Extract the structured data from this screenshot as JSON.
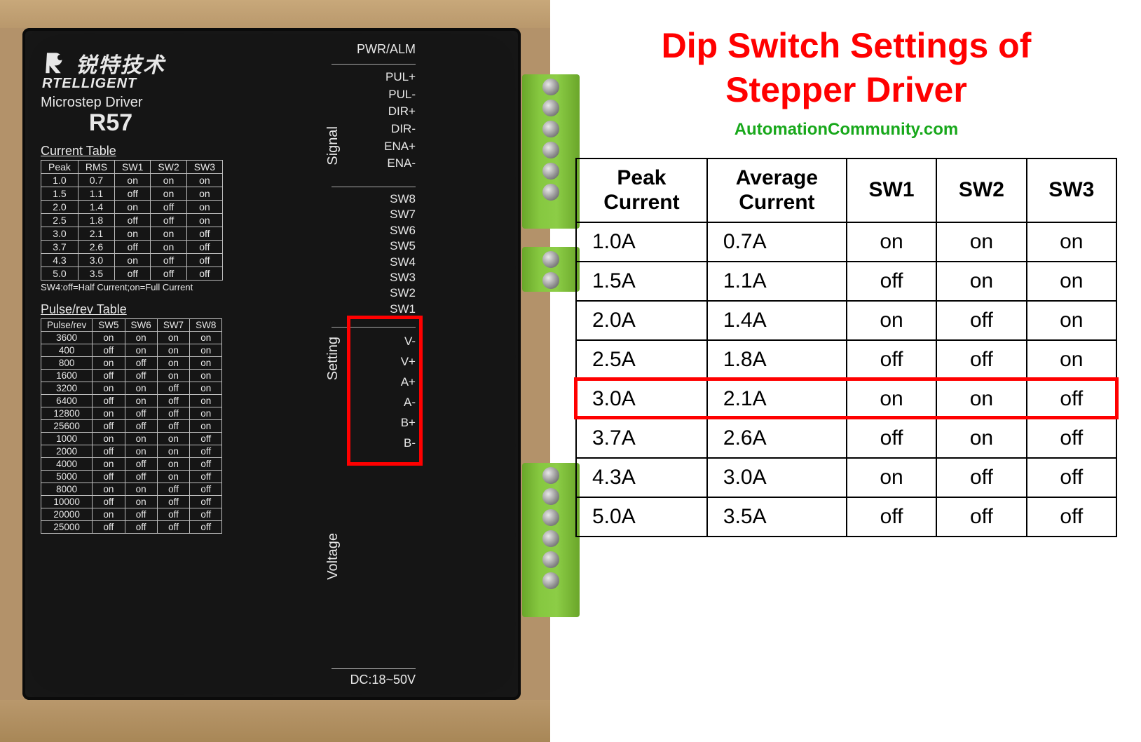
{
  "left": {
    "brand_cn": "锐特技术",
    "brand_en": "RTELLIGENT",
    "model_line": "Microstep Driver",
    "model": "R57",
    "current_table": {
      "title": "Current Table",
      "headers": [
        "Peak",
        "RMS",
        "SW1",
        "SW2",
        "SW3"
      ],
      "rows": [
        [
          "1.0",
          "0.7",
          "on",
          "on",
          "on"
        ],
        [
          "1.5",
          "1.1",
          "off",
          "on",
          "on"
        ],
        [
          "2.0",
          "1.4",
          "on",
          "off",
          "on"
        ],
        [
          "2.5",
          "1.8",
          "off",
          "off",
          "on"
        ],
        [
          "3.0",
          "2.1",
          "on",
          "on",
          "off"
        ],
        [
          "3.7",
          "2.6",
          "off",
          "on",
          "off"
        ],
        [
          "4.3",
          "3.0",
          "on",
          "off",
          "off"
        ],
        [
          "5.0",
          "3.5",
          "off",
          "off",
          "off"
        ]
      ],
      "note": "SW4:off=Half Current;on=Full Current"
    },
    "pulse_table": {
      "title": "Pulse/rev Table",
      "headers": [
        "Pulse/rev",
        "SW5",
        "SW6",
        "SW7",
        "SW8"
      ],
      "rows": [
        [
          "3600",
          "on",
          "on",
          "on",
          "on"
        ],
        [
          "400",
          "off",
          "on",
          "on",
          "on"
        ],
        [
          "800",
          "on",
          "off",
          "on",
          "on"
        ],
        [
          "1600",
          "off",
          "off",
          "on",
          "on"
        ],
        [
          "3200",
          "on",
          "on",
          "off",
          "on"
        ],
        [
          "6400",
          "off",
          "on",
          "off",
          "on"
        ],
        [
          "12800",
          "on",
          "off",
          "off",
          "on"
        ],
        [
          "25600",
          "off",
          "off",
          "off",
          "on"
        ],
        [
          "1000",
          "on",
          "on",
          "on",
          "off"
        ],
        [
          "2000",
          "off",
          "on",
          "on",
          "off"
        ],
        [
          "4000",
          "on",
          "off",
          "on",
          "off"
        ],
        [
          "5000",
          "off",
          "off",
          "on",
          "off"
        ],
        [
          "8000",
          "on",
          "on",
          "off",
          "off"
        ],
        [
          "10000",
          "off",
          "on",
          "off",
          "off"
        ],
        [
          "20000",
          "on",
          "off",
          "off",
          "off"
        ],
        [
          "25000",
          "off",
          "off",
          "off",
          "off"
        ]
      ]
    },
    "pins": {
      "pwr": "PWR/ALM",
      "signal_group": "Signal",
      "signal": [
        "PUL+",
        "PUL-",
        "DIR+",
        "DIR-",
        "ENA+",
        "ENA-"
      ],
      "setting_group": "Setting",
      "setting": [
        "SW8",
        "SW7",
        "SW6",
        "SW5",
        "SW4",
        "SW3",
        "SW2",
        "SW1"
      ],
      "voltage_group": "Voltage",
      "voltage": [
        "V-",
        "V+",
        "A+",
        "A-",
        "B+",
        "B-"
      ],
      "dc": "DC:18~50V"
    }
  },
  "right": {
    "title_line1": "Dip Switch Settings of",
    "title_line2": "Stepper Driver",
    "source": "AutomationCommunity.com",
    "headers": [
      "Peak Current",
      "Average Current",
      "SW1",
      "SW2",
      "SW3"
    ],
    "rows": [
      [
        "1.0A",
        "0.7A",
        "on",
        "on",
        "on"
      ],
      [
        "1.5A",
        "1.1A",
        "off",
        "on",
        "on"
      ],
      [
        "2.0A",
        "1.4A",
        "on",
        "off",
        "on"
      ],
      [
        "2.5A",
        "1.8A",
        "off",
        "off",
        "on"
      ],
      [
        "3.0A",
        "2.1A",
        "on",
        "on",
        "off"
      ],
      [
        "3.7A",
        "2.6A",
        "off",
        "on",
        "off"
      ],
      [
        "4.3A",
        "3.0A",
        "on",
        "off",
        "off"
      ],
      [
        "5.0A",
        "3.5A",
        "off",
        "off",
        "off"
      ]
    ],
    "highlight_row_index": 4
  },
  "chart_data": {
    "type": "table",
    "title": "Dip Switch Settings of Stepper Driver",
    "columns": [
      "Peak Current (A)",
      "Average Current (A)",
      "SW1",
      "SW2",
      "SW3"
    ],
    "rows": [
      [
        1.0,
        0.7,
        "on",
        "on",
        "on"
      ],
      [
        1.5,
        1.1,
        "off",
        "on",
        "on"
      ],
      [
        2.0,
        1.4,
        "on",
        "off",
        "on"
      ],
      [
        2.5,
        1.8,
        "off",
        "off",
        "on"
      ],
      [
        3.0,
        2.1,
        "on",
        "on",
        "off"
      ],
      [
        3.7,
        2.6,
        "off",
        "on",
        "off"
      ],
      [
        4.3,
        3.0,
        "on",
        "off",
        "off"
      ],
      [
        5.0,
        3.5,
        "off",
        "off",
        "off"
      ]
    ],
    "highlighted_row": {
      "peak": 3.0,
      "avg": 2.1,
      "sw": [
        "on",
        "on",
        "off"
      ]
    }
  }
}
